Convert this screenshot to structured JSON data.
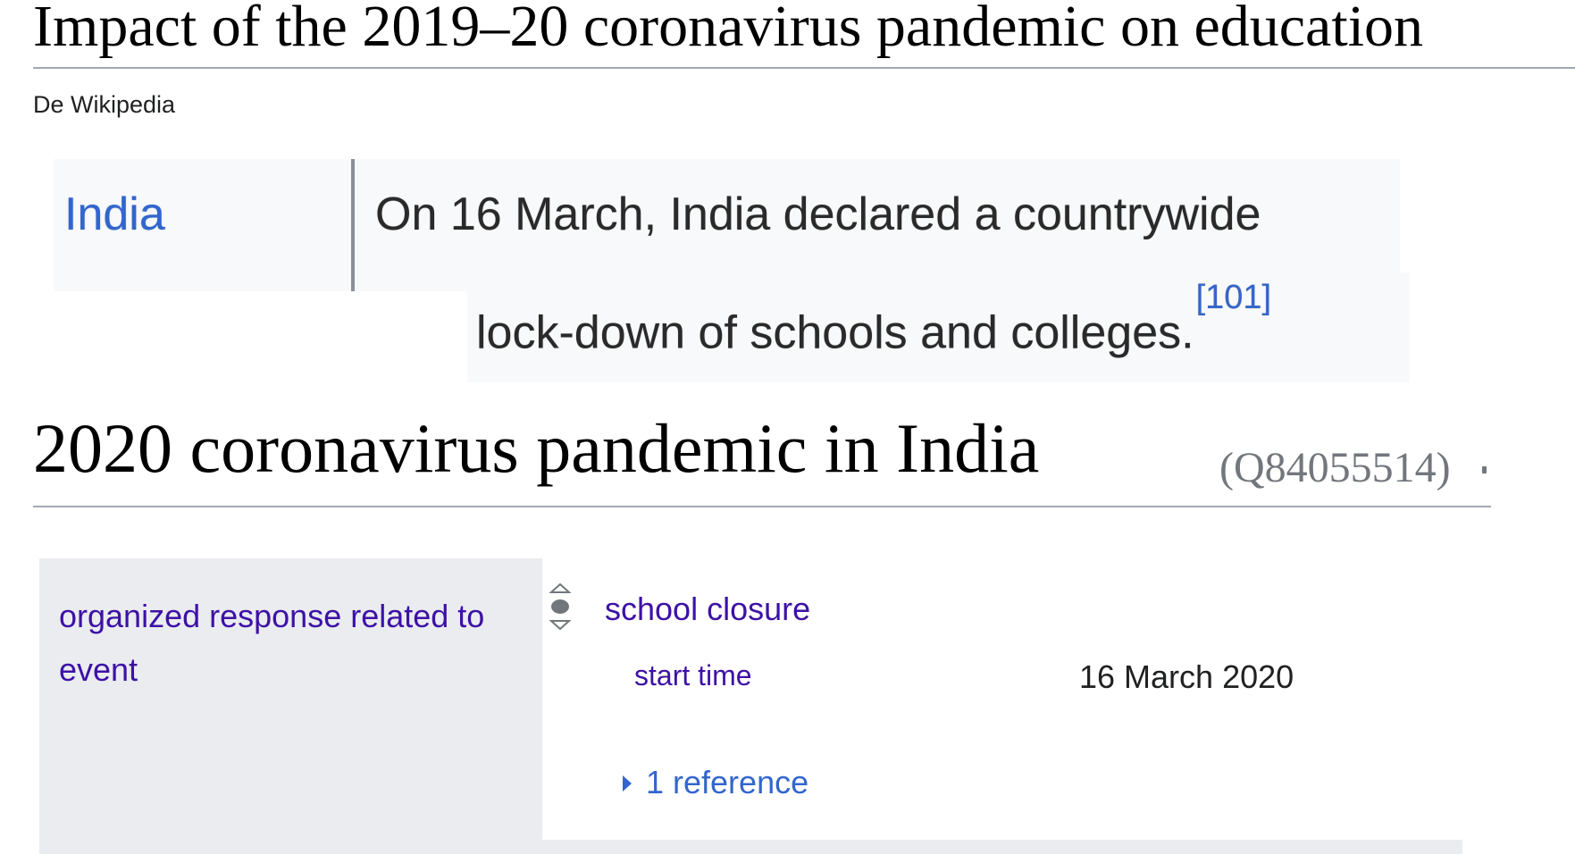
{
  "article": {
    "title": "Impact of the 2019–20 coronavirus pandemic on education",
    "source": "De Wikipedia"
  },
  "quote": {
    "country": "India",
    "line1": "On 16 March, India declared a countrywide",
    "line2": "lock-down of schools and colleges.",
    "ref": "[101]"
  },
  "wikidata": {
    "item_label": "2020 coronavirus pandemic in India",
    "item_id": "(Q84055514)",
    "statement": {
      "property": "organized response related to event",
      "value": "school closure",
      "qualifier_property": "start time",
      "qualifier_value": "16 March 2020",
      "references": "1 reference"
    }
  },
  "colors": {
    "link": "#3366cc",
    "visited_link": "#3d11a6",
    "muted": "#72777d",
    "rule": "#a2a9b1",
    "statement_bg": "#eaecf0"
  },
  "icons": {
    "rank": "normal-rank-icon",
    "expand": "triangle-right-icon"
  }
}
